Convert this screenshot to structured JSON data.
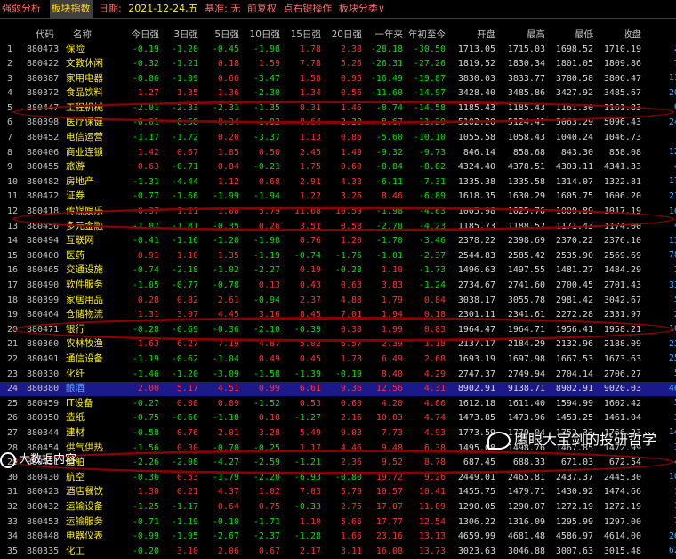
{
  "toolbar": {
    "tab_strength": "强弱分析",
    "tab_index": "板块指数",
    "date_label": "日期:",
    "date_value": "2021-12-24,五",
    "base_label": "基准: 无",
    "adjust_label": "前复权",
    "right_click_label": "点右键操作",
    "category_dropdown": "板块分类∨"
  },
  "columns": [
    "",
    "代码",
    "名称",
    "今日强",
    "3日强",
    "5日强",
    "10日强",
    "15日强",
    "20日强",
    "一年来",
    "年初至今",
    "开盘",
    "最高",
    "最低",
    "收盘",
    "总金额"
  ],
  "unit_label": "亿",
  "selected_row": 24,
  "rows": [
    {
      "idx": "1",
      "code": "880473",
      "name": "保险",
      "v": [
        "-0.19",
        "-1.20",
        "-0.45",
        "-1.98",
        "1.78",
        "2.38",
        "-28.18",
        "-30.50",
        "1713.05",
        "1715.03",
        "1698.52",
        "1710.19",
        "27.3"
      ]
    },
    {
      "idx": "2",
      "code": "880422",
      "name": "文教休闲",
      "v": [
        "-0.32",
        "-1.21",
        "0.18",
        "1.59",
        "7.78",
        "5.26",
        "-26.31",
        "-27.26",
        "1819.52",
        "1830.34",
        "1801.05",
        "1809.86",
        "76.8"
      ]
    },
    {
      "idx": "3",
      "code": "880387",
      "name": "家用电器",
      "v": [
        "-0.86",
        "-1.09",
        "0.66",
        "-3.47",
        "1.58",
        "0.95",
        "-16.49",
        "-19.87",
        "3830.03",
        "3833.77",
        "3780.58",
        "3806.47",
        "111.6"
      ]
    },
    {
      "idx": "4",
      "code": "880372",
      "name": "食品饮料",
      "v": [
        "1.27",
        "1.35",
        "1.36",
        "-2.30",
        "1.34",
        "0.56",
        "-11.60",
        "-14.97",
        "3428.40",
        "3485.86",
        "3427.92",
        "3485.67",
        "202.5"
      ]
    },
    {
      "idx": "5",
      "code": "880447",
      "name": "工程机械",
      "v": [
        "-2.01",
        "-2.33",
        "-2.31",
        "-1.35",
        "0.31",
        "1.46",
        "-8.74",
        "-14.58",
        "1185.43",
        "1185.43",
        "1161.30",
        "1161.83",
        "64.4"
      ]
    },
    {
      "idx": "6",
      "code": "880398",
      "name": "医疗保健",
      "v": [
        "-0.01",
        "-0.58",
        "0.34",
        "-1.92",
        "0.64",
        "-2.30",
        "-8.67",
        "-11.29",
        "5102.20",
        "5124.41",
        "5063.29",
        "5096.43",
        "244.0"
      ]
    },
    {
      "idx": "7",
      "code": "880452",
      "name": "电信运营",
      "v": [
        "-1.17",
        "-1.72",
        "0.20",
        "-3.37",
        "1.13",
        "0.86",
        "-5.60",
        "-10.10",
        "1055.58",
        "1058.43",
        "1040.24",
        "1046.73",
        "1.8"
      ]
    },
    {
      "idx": "8",
      "code": "880406",
      "name": "商业连锁",
      "v": [
        "1.42",
        "0.67",
        "1.85",
        "0.50",
        "2.45",
        "1.49",
        "-9.32",
        "-9.73",
        "846.14",
        "858.68",
        "843.30",
        "858.08",
        "127.0"
      ]
    },
    {
      "idx": "9",
      "code": "880455",
      "name": "旅游",
      "v": [
        "0.63",
        "-0.71",
        "0.84",
        "-0.21",
        "1.75",
        "0.60",
        "-8.84",
        "-8.82",
        "4324.40",
        "4378.51",
        "4303.11",
        "4341.33",
        "41.7"
      ]
    },
    {
      "idx": "10",
      "code": "880482",
      "name": "房地产",
      "v": [
        "-1.31",
        "-4.44",
        "1.12",
        "0.68",
        "2.91",
        "4.33",
        "-6.11",
        "-7.31",
        "1335.38",
        "1335.58",
        "1314.07",
        "1322.81",
        "179.4"
      ]
    },
    {
      "idx": "11",
      "code": "880472",
      "name": "证券",
      "v": [
        "-0.77",
        "-1.66",
        "-1.99",
        "-1.94",
        "1.22",
        "3.26",
        "8.46",
        "-6.89",
        "1618.35",
        "1630.29",
        "1605.75",
        "1606.20",
        "210.0"
      ]
    },
    {
      "idx": "12",
      "code": "880418",
      "name": "传媒娱乐",
      "v": [
        "0.37",
        "1.21",
        "1.00",
        "5.79",
        "11.68",
        "10.59",
        "-1.98",
        "-4.63",
        "1005.98",
        "1025.76",
        "1009.89",
        "1017.19",
        "160.5"
      ]
    },
    {
      "idx": "13",
      "code": "880456",
      "name": "多元金融",
      "v": [
        "-1.07",
        "-1.81",
        "-0.35",
        "0.26",
        "3.51",
        "0.58",
        "-2.78",
        "-4.23",
        "1185.73",
        "1188.52",
        "1171.43",
        "1174.00",
        "48.4"
      ]
    },
    {
      "idx": "14",
      "code": "880494",
      "name": "互联网",
      "v": [
        "-0.41",
        "-1.16",
        "-1.20",
        "-1.98",
        "0.76",
        "1.20",
        "-1.70",
        "-3.46",
        "2378.22",
        "2398.69",
        "2370.22",
        "2376.10",
        "134.9"
      ]
    },
    {
      "idx": "15",
      "code": "880400",
      "name": "医药",
      "v": [
        "0.91",
        "1.10",
        "1.35",
        "-1.19",
        "-0.74",
        "-1.76",
        "-1.01",
        "-2.37",
        "2544.83",
        "2585.42",
        "2535.90",
        "2569.69",
        "781.3"
      ]
    },
    {
      "idx": "16",
      "code": "880465",
      "name": "交通设施",
      "v": [
        "-0.74",
        "-2.18",
        "-1.02",
        "-2.27",
        "0.19",
        "-0.28",
        "1.10",
        "-1.73",
        "1496.63",
        "1497.55",
        "1481.27",
        "1484.29",
        "24.7"
      ]
    },
    {
      "idx": "17",
      "code": "880490",
      "name": "软件服务",
      "v": [
        "-1.05",
        "-0.77",
        "-0.78",
        "0.13",
        "0.43",
        "0.63",
        "3.83",
        "-1.24",
        "2734.67",
        "2741.60",
        "2700.45",
        "2701.43",
        "330.0"
      ]
    },
    {
      "idx": "18",
      "code": "880399",
      "name": "家居用品",
      "v": [
        "0.28",
        "0.82",
        "2.61",
        "-0.94",
        "2.37",
        "4.88",
        "1.79",
        "0.84",
        "3038.17",
        "3055.78",
        "2981.42",
        "3042.67",
        "51.3"
      ]
    },
    {
      "idx": "19",
      "code": "880464",
      "name": "仓储物流",
      "v": [
        "1.31",
        "3.07",
        "4.45",
        "3.16",
        "8.45",
        "7.01",
        "1.94",
        "0.18",
        "2301.11",
        "2341.61",
        "2272.28",
        "2331.97",
        "29.9"
      ]
    },
    {
      "idx": "20",
      "code": "880471",
      "name": "银行",
      "v": [
        "-0.28",
        "-0.69",
        "-0.36",
        "-2.10",
        "-0.39",
        "0.38",
        "1.99",
        "0.83",
        "1964.47",
        "1964.71",
        "1956.41",
        "1958.21",
        "103.4"
      ]
    },
    {
      "idx": "21",
      "code": "880360",
      "name": "农林牧渔",
      "v": [
        "1.63",
        "6.27",
        "7.19",
        "4.87",
        "5.02",
        "6.57",
        "2.39",
        "1.18",
        "2137.17",
        "2184.29",
        "2132.96",
        "2188.09",
        "232.8"
      ]
    },
    {
      "idx": "22",
      "code": "880491",
      "name": "通信设备",
      "v": [
        "-1.19",
        "-0.62",
        "-1.04",
        "0.49",
        "0.45",
        "1.73",
        "6.49",
        "2.68",
        "1693.19",
        "1697.98",
        "1667.53",
        "1673.63",
        "253.6"
      ]
    },
    {
      "idx": "23",
      "code": "880330",
      "name": "化纤",
      "v": [
        "-1.46",
        "-1.20",
        "-3.09",
        "-1.58",
        "-1.39",
        "-0.19",
        "8.40",
        "4.29",
        "2747.37",
        "2749.94",
        "2704.14",
        "2706.27",
        "53.3"
      ]
    },
    {
      "idx": "24",
      "code": "880380",
      "name": "酿酒",
      "v": [
        "2.00",
        "5.17",
        "4.51",
        "0.99",
        "6.61",
        "9.36",
        "12.56",
        "4.31",
        "8902.91",
        "9138.71",
        "8902.91",
        "9020.03",
        "460.0"
      ]
    },
    {
      "idx": "25",
      "code": "880459",
      "name": "IT设备",
      "v": [
        "-0.27",
        "0.08",
        "0.89",
        "-1.52",
        "0.53",
        "0.60",
        "4.20",
        "4.66",
        "1612.18",
        "1611.40",
        "1594.99",
        "1602.42",
        "57.9"
      ]
    },
    {
      "idx": "26",
      "code": "880350",
      "name": "造纸",
      "v": [
        "-0.75",
        "-0.60",
        "-1.18",
        "0.18",
        "-1.27",
        "2.16",
        "10.03",
        "4.74",
        "1473.85",
        "1473.96",
        "1453.25",
        "1461.04",
        "34.7"
      ]
    },
    {
      "idx": "27",
      "code": "880344",
      "name": "建材",
      "v": [
        "-0.58",
        "0.76",
        "2.01",
        "3.28",
        "5.49",
        "9.03",
        "7.73",
        "4.93",
        "1773.59",
        "1779.04",
        "1752.33",
        "1766.23",
        "140.0"
      ]
    },
    {
      "idx": "28",
      "code": "880454",
      "name": "供气供热",
      "v": [
        "-1.56",
        "0.30",
        "-0.70",
        "-0.25",
        "1.17",
        "4.46",
        "9.48",
        "6.38",
        "1495.08",
        "1498.76",
        "1467.85",
        "1472.99",
        "33.0"
      ]
    },
    {
      "idx": "29",
      "code": "880431",
      "name": "船舶",
      "v": [
        "-2.26",
        "-2.98",
        "-4.27",
        "-2.59",
        "-1.21",
        "2.36",
        "9.52",
        "8.78",
        "687.45",
        "688.33",
        "671.03",
        "672.54",
        "48.9"
      ]
    },
    {
      "idx": "30",
      "code": "880430",
      "name": "航空",
      "v": [
        "-0.36",
        "0.53",
        "-1.79",
        "-2.20",
        "-6.93",
        "-0.80",
        "19.72",
        "9.26",
        "2449.01",
        "2465.81",
        "2437.37",
        "2445.30",
        "102.6"
      ]
    },
    {
      "idx": "31",
      "code": "880423",
      "name": "酒店餐饮",
      "v": [
        "1.30",
        "0.21",
        "4.37",
        "1.02",
        "7.03",
        "5.79",
        "10.57",
        "10.41",
        "1455.75",
        "1479.71",
        "1430.92",
        "1474.66",
        "12.2"
      ]
    },
    {
      "idx": "32",
      "code": "880432",
      "name": "运输设备",
      "v": [
        "-1.25",
        "-1.17",
        "0.64",
        "0.75",
        "-0.33",
        "2.75",
        "17.07",
        "11.09",
        "1290.05",
        "1290.07",
        "1272.19",
        "1272.19",
        "12.9"
      ]
    },
    {
      "idx": "33",
      "code": "880453",
      "name": "运输服务",
      "v": [
        "-0.71",
        "-1.19",
        "-0.10",
        "-1.71",
        "1.10",
        "5.66",
        "17.77",
        "12.54",
        "1306.22",
        "1316.09",
        "1295.99",
        "1297.00",
        "25.8"
      ]
    },
    {
      "idx": "34",
      "code": "880448",
      "name": "电器仪表",
      "v": [
        "-0.99",
        "-1.95",
        "-2.67",
        "-2.37",
        "-1.28",
        "1.66",
        "23.16",
        "13.13",
        "4659.99",
        "4681.48",
        "4586.97",
        "4614.00",
        "260.0"
      ]
    },
    {
      "idx": "35",
      "code": "880335",
      "name": "化工",
      "v": [
        "-0.20",
        "3.10",
        "2.06",
        "0.67",
        "2.17",
        "3.11",
        "16.08",
        "13.73",
        "3023.63",
        "3046.88",
        "3007.63",
        "3015.48",
        "620.0"
      ]
    }
  ],
  "overlay": {
    "watermark_text": "鹰眼大宝剑的投研哲学",
    "corner_logo_text": "大数据内容"
  },
  "colors": {
    "up": "#ff3030",
    "down": "#00e000",
    "name": "#fff000",
    "amount": "#3fa9ff",
    "circle": "#8b0000"
  }
}
